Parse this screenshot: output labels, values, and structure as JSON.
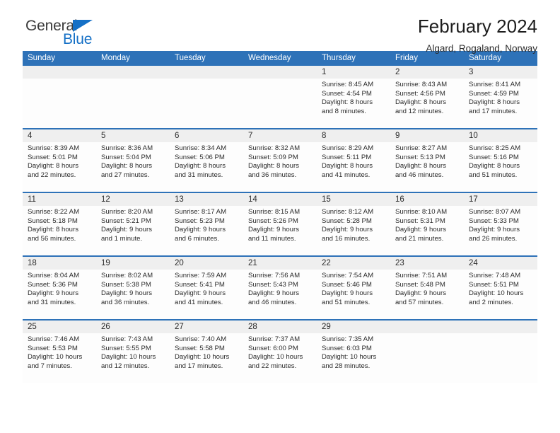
{
  "brand": {
    "name_part1": "General",
    "name_part2": "Blue",
    "triangle_color": "#1570c6",
    "logo_icon": "triangle-icon"
  },
  "header": {
    "title": "February 2024",
    "subtitle": "Algard, Rogaland, Norway"
  },
  "colors": {
    "header_blue": "#2e72b8",
    "daynum_band": "#efefef",
    "cell_bg": "#fdfdfd",
    "text": "#2b2b2b",
    "brand_blue": "#1570c6"
  },
  "weekdays": [
    "Sunday",
    "Monday",
    "Tuesday",
    "Wednesday",
    "Thursday",
    "Friday",
    "Saturday"
  ],
  "weeks": [
    [
      {
        "day": "",
        "lines": []
      },
      {
        "day": "",
        "lines": []
      },
      {
        "day": "",
        "lines": []
      },
      {
        "day": "",
        "lines": []
      },
      {
        "day": "1",
        "lines": [
          "Sunrise: 8:45 AM",
          "Sunset: 4:54 PM",
          "Daylight: 8 hours",
          "and 8 minutes."
        ]
      },
      {
        "day": "2",
        "lines": [
          "Sunrise: 8:43 AM",
          "Sunset: 4:56 PM",
          "Daylight: 8 hours",
          "and 12 minutes."
        ]
      },
      {
        "day": "3",
        "lines": [
          "Sunrise: 8:41 AM",
          "Sunset: 4:59 PM",
          "Daylight: 8 hours",
          "and 17 minutes."
        ]
      }
    ],
    [
      {
        "day": "4",
        "lines": [
          "Sunrise: 8:39 AM",
          "Sunset: 5:01 PM",
          "Daylight: 8 hours",
          "and 22 minutes."
        ]
      },
      {
        "day": "5",
        "lines": [
          "Sunrise: 8:36 AM",
          "Sunset: 5:04 PM",
          "Daylight: 8 hours",
          "and 27 minutes."
        ]
      },
      {
        "day": "6",
        "lines": [
          "Sunrise: 8:34 AM",
          "Sunset: 5:06 PM",
          "Daylight: 8 hours",
          "and 31 minutes."
        ]
      },
      {
        "day": "7",
        "lines": [
          "Sunrise: 8:32 AM",
          "Sunset: 5:09 PM",
          "Daylight: 8 hours",
          "and 36 minutes."
        ]
      },
      {
        "day": "8",
        "lines": [
          "Sunrise: 8:29 AM",
          "Sunset: 5:11 PM",
          "Daylight: 8 hours",
          "and 41 minutes."
        ]
      },
      {
        "day": "9",
        "lines": [
          "Sunrise: 8:27 AM",
          "Sunset: 5:13 PM",
          "Daylight: 8 hours",
          "and 46 minutes."
        ]
      },
      {
        "day": "10",
        "lines": [
          "Sunrise: 8:25 AM",
          "Sunset: 5:16 PM",
          "Daylight: 8 hours",
          "and 51 minutes."
        ]
      }
    ],
    [
      {
        "day": "11",
        "lines": [
          "Sunrise: 8:22 AM",
          "Sunset: 5:18 PM",
          "Daylight: 8 hours",
          "and 56 minutes."
        ]
      },
      {
        "day": "12",
        "lines": [
          "Sunrise: 8:20 AM",
          "Sunset: 5:21 PM",
          "Daylight: 9 hours",
          "and 1 minute."
        ]
      },
      {
        "day": "13",
        "lines": [
          "Sunrise: 8:17 AM",
          "Sunset: 5:23 PM",
          "Daylight: 9 hours",
          "and 6 minutes."
        ]
      },
      {
        "day": "14",
        "lines": [
          "Sunrise: 8:15 AM",
          "Sunset: 5:26 PM",
          "Daylight: 9 hours",
          "and 11 minutes."
        ]
      },
      {
        "day": "15",
        "lines": [
          "Sunrise: 8:12 AM",
          "Sunset: 5:28 PM",
          "Daylight: 9 hours",
          "and 16 minutes."
        ]
      },
      {
        "day": "16",
        "lines": [
          "Sunrise: 8:10 AM",
          "Sunset: 5:31 PM",
          "Daylight: 9 hours",
          "and 21 minutes."
        ]
      },
      {
        "day": "17",
        "lines": [
          "Sunrise: 8:07 AM",
          "Sunset: 5:33 PM",
          "Daylight: 9 hours",
          "and 26 minutes."
        ]
      }
    ],
    [
      {
        "day": "18",
        "lines": [
          "Sunrise: 8:04 AM",
          "Sunset: 5:36 PM",
          "Daylight: 9 hours",
          "and 31 minutes."
        ]
      },
      {
        "day": "19",
        "lines": [
          "Sunrise: 8:02 AM",
          "Sunset: 5:38 PM",
          "Daylight: 9 hours",
          "and 36 minutes."
        ]
      },
      {
        "day": "20",
        "lines": [
          "Sunrise: 7:59 AM",
          "Sunset: 5:41 PM",
          "Daylight: 9 hours",
          "and 41 minutes."
        ]
      },
      {
        "day": "21",
        "lines": [
          "Sunrise: 7:56 AM",
          "Sunset: 5:43 PM",
          "Daylight: 9 hours",
          "and 46 minutes."
        ]
      },
      {
        "day": "22",
        "lines": [
          "Sunrise: 7:54 AM",
          "Sunset: 5:46 PM",
          "Daylight: 9 hours",
          "and 51 minutes."
        ]
      },
      {
        "day": "23",
        "lines": [
          "Sunrise: 7:51 AM",
          "Sunset: 5:48 PM",
          "Daylight: 9 hours",
          "and 57 minutes."
        ]
      },
      {
        "day": "24",
        "lines": [
          "Sunrise: 7:48 AM",
          "Sunset: 5:51 PM",
          "Daylight: 10 hours",
          "and 2 minutes."
        ]
      }
    ],
    [
      {
        "day": "25",
        "lines": [
          "Sunrise: 7:46 AM",
          "Sunset: 5:53 PM",
          "Daylight: 10 hours",
          "and 7 minutes."
        ]
      },
      {
        "day": "26",
        "lines": [
          "Sunrise: 7:43 AM",
          "Sunset: 5:55 PM",
          "Daylight: 10 hours",
          "and 12 minutes."
        ]
      },
      {
        "day": "27",
        "lines": [
          "Sunrise: 7:40 AM",
          "Sunset: 5:58 PM",
          "Daylight: 10 hours",
          "and 17 minutes."
        ]
      },
      {
        "day": "28",
        "lines": [
          "Sunrise: 7:37 AM",
          "Sunset: 6:00 PM",
          "Daylight: 10 hours",
          "and 22 minutes."
        ]
      },
      {
        "day": "29",
        "lines": [
          "Sunrise: 7:35 AM",
          "Sunset: 6:03 PM",
          "Daylight: 10 hours",
          "and 28 minutes."
        ]
      },
      {
        "day": "",
        "lines": []
      },
      {
        "day": "",
        "lines": []
      }
    ]
  ]
}
